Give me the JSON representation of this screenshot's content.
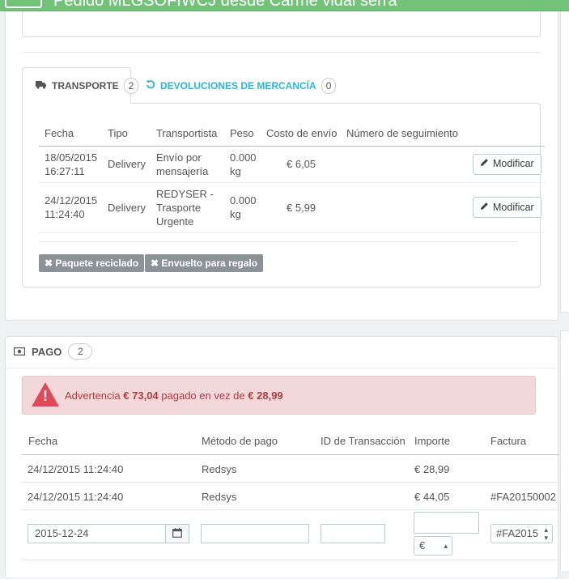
{
  "header": {
    "title": "Pedido MLGSOFIWCJ desde Carme vidal serra"
  },
  "shipping": {
    "tabs": [
      {
        "label": "TRANSPORTE",
        "count": "2"
      },
      {
        "label": "DEVOLUCIONES DE MERCANCÍA",
        "count": "0"
      }
    ],
    "columns": [
      "Fecha",
      "Tipo",
      "Transportista",
      "Peso",
      "Costo de envío",
      "Número de seguimiento"
    ],
    "rows": [
      {
        "date": "18/05/2015",
        "time": "16:27:11",
        "type": "Delivery",
        "carrier_l1": "Envío por",
        "carrier_l2": "mensajería",
        "carrier_l3": "",
        "weight_l1": "0.000",
        "weight_l2": "kg",
        "cost": "€ 6,05",
        "tracking": "",
        "action": "Modificar"
      },
      {
        "date": "24/12/2015",
        "time": "11:24:40",
        "type": "Delivery",
        "carrier_l1": "REDYSER -",
        "carrier_l2": "Trasporte",
        "carrier_l3": "Urgente",
        "weight_l1": "0.000",
        "weight_l2": "kg",
        "cost": "€ 5,99",
        "tracking": "",
        "action": "Modificar"
      }
    ],
    "badges": [
      "Paquete reciclado",
      "Envuelto para regalo"
    ]
  },
  "payment": {
    "title": "PAGO",
    "count": "2",
    "alert": {
      "prefix": "Advertencia",
      "paid": "€ 73,04",
      "middle": "pagado en vez de",
      "expected": "€ 28,99"
    },
    "columns": [
      "Fecha",
      "Método de pago",
      "ID de Transacción",
      "Importe",
      "Factura"
    ],
    "rows": [
      {
        "date": "24/12/2015 11:24:40",
        "method": "Redsys",
        "transaction": "",
        "amount": "€ 28,99",
        "invoice": ""
      },
      {
        "date": "24/12/2015 11:24:40",
        "method": "Redsys",
        "transaction": "",
        "amount": "€ 44,05",
        "invoice": "#FA20150002"
      }
    ],
    "form": {
      "date": "2015-12-24",
      "method": "",
      "transaction": "",
      "amount": "",
      "currency": "€",
      "invoice": "#FA2015"
    }
  },
  "colors": {
    "accent": "#25b9d7",
    "header_green": "#72c279",
    "alert_bg": "#f3d8da",
    "alert_text": "#b13a3e",
    "badge_gray": "#8c9396"
  }
}
